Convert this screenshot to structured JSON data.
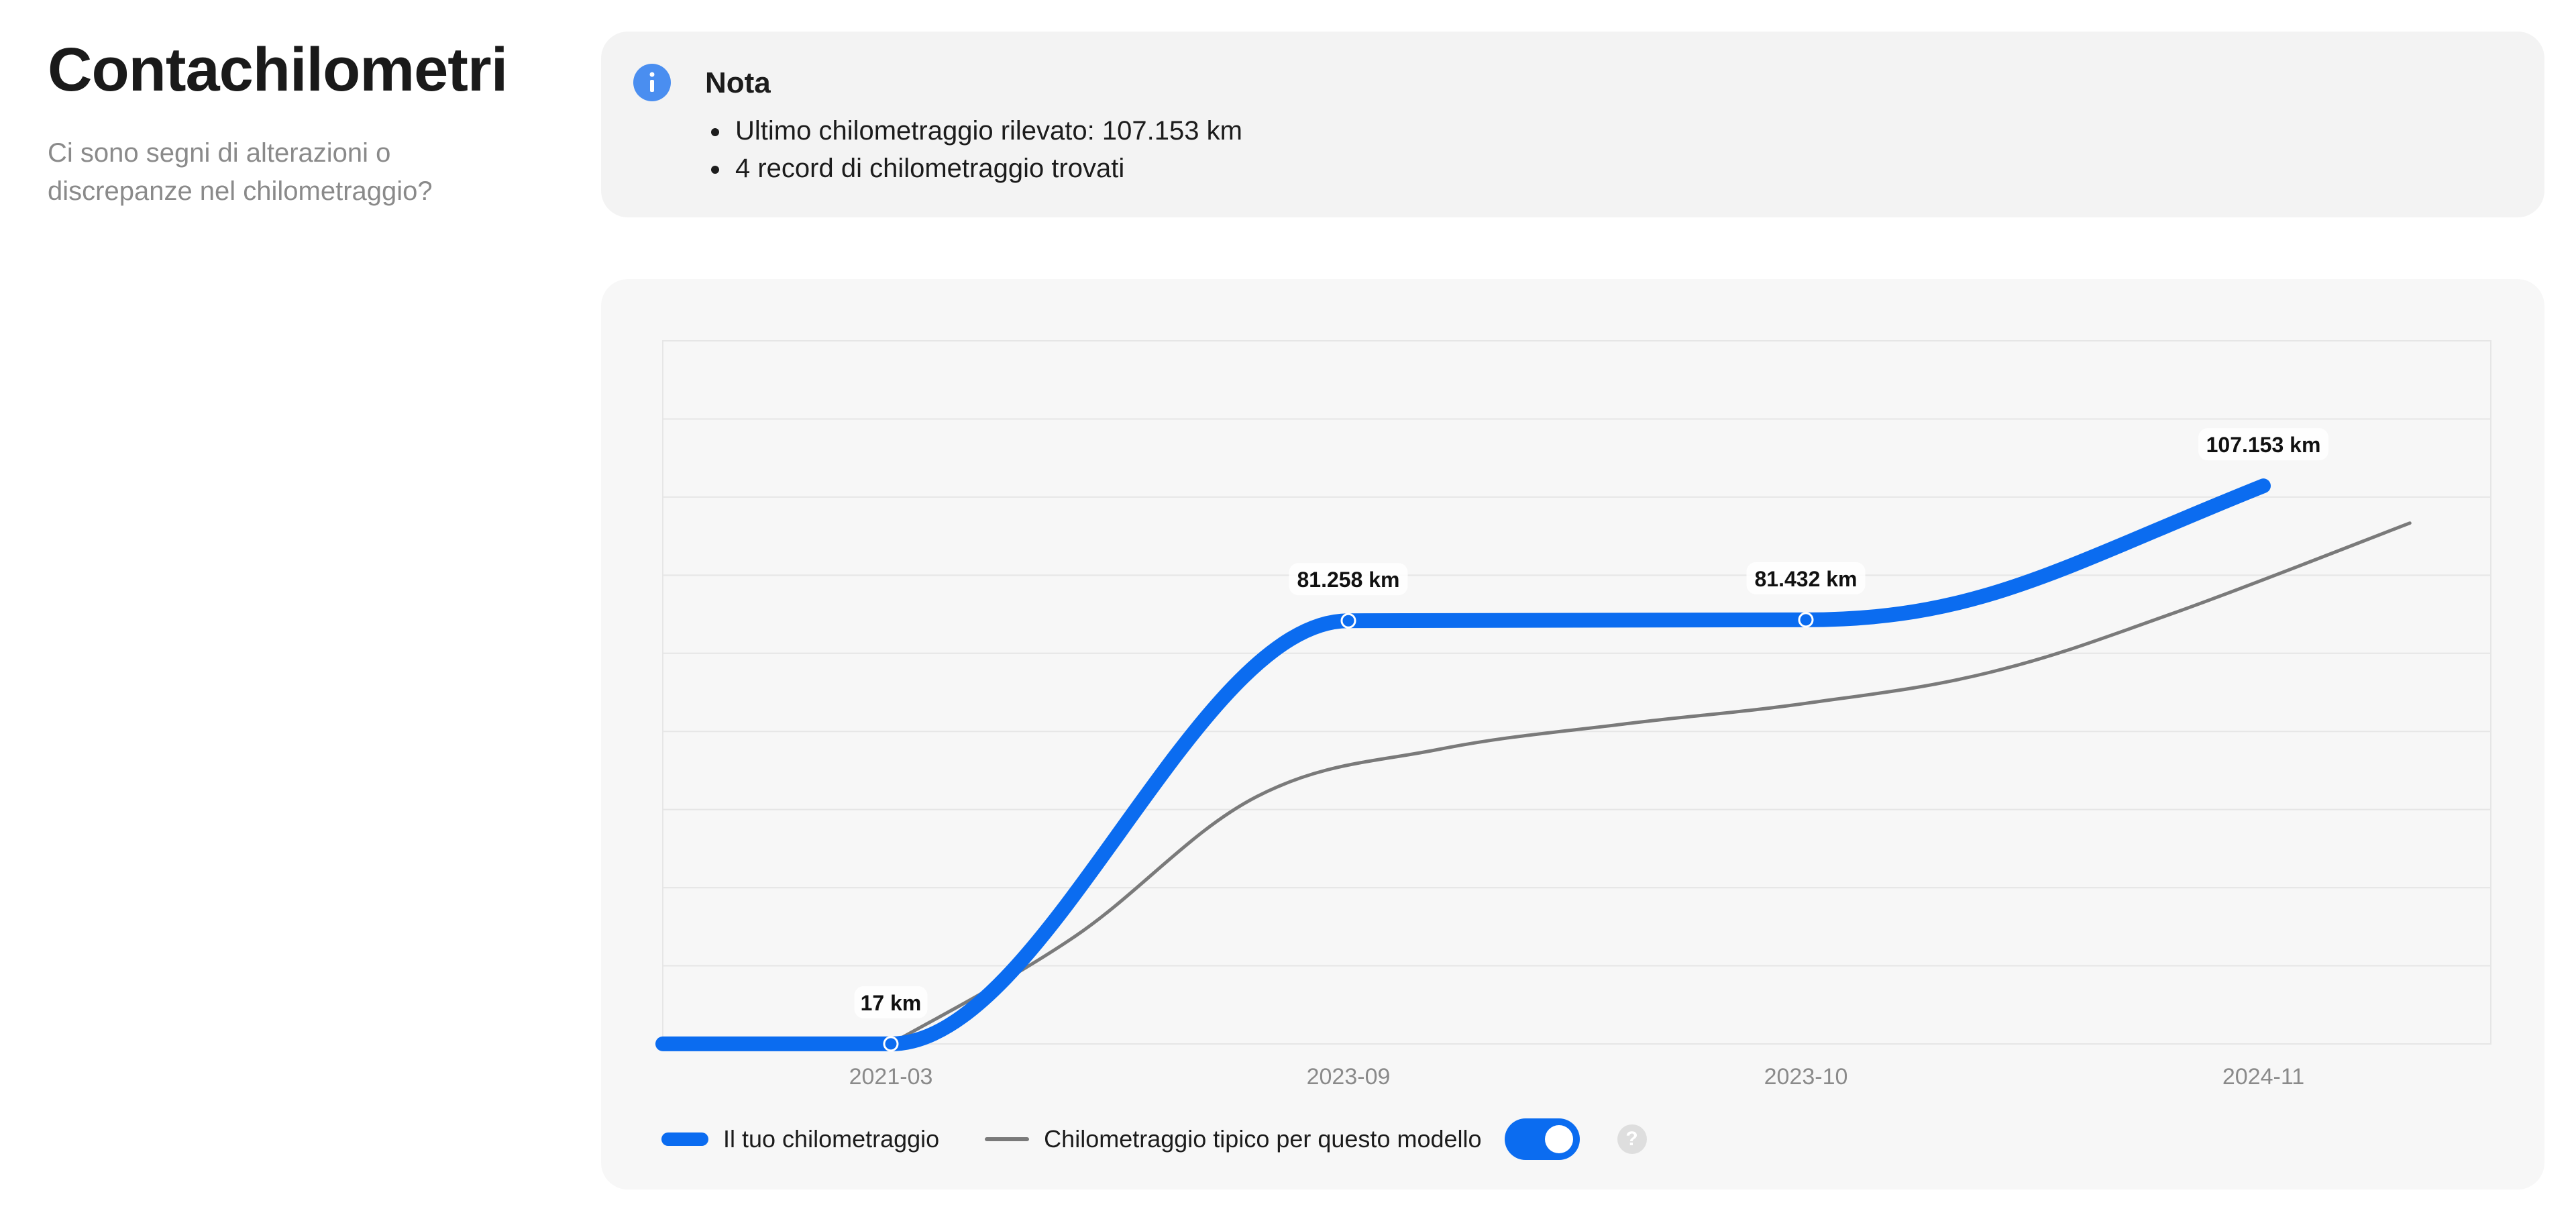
{
  "page": {
    "title": "Contachilometri",
    "subtitle": "Ci sono segni di alterazioni o discrepanze nel chilometraggio?"
  },
  "note": {
    "title": "Nota",
    "icon": "info-icon",
    "items": [
      "Ultimo chilometraggio rilevato: 107.153 km",
      "4 record di chilometraggio trovati"
    ]
  },
  "legend": {
    "yours_label": "Il tuo chilometraggio",
    "typical_label": "Chilometraggio tipico per questo modello",
    "toggle_on": true,
    "help_icon": "?"
  },
  "colors": {
    "accent": "#0b6cf0",
    "typical_line": "#7a7a7a",
    "info_icon": "#4a8ef0"
  },
  "chart_data": {
    "type": "line",
    "categories": [
      "2021-03",
      "2023-09",
      "2023-10",
      "2024-11"
    ],
    "ylim": [
      0,
      135000
    ],
    "grid": true,
    "series": [
      {
        "name": "Il tuo chilometraggio",
        "values": [
          17,
          81258,
          81432,
          107153
        ],
        "labels": [
          "17 km",
          "81.258 km",
          "81.432 km",
          "107.153 km"
        ]
      },
      {
        "name": "Chilometraggio tipico per questo modello",
        "x": [
          0,
          0.4,
          0.8,
          1.2,
          1.6,
          2.0,
          2.4,
          2.8,
          3.32
        ],
        "values": [
          17,
          20500,
          47500,
          56600,
          61400,
          65400,
          71300,
          82600,
          100000
        ]
      }
    ],
    "legend_position": "bottom-left"
  }
}
